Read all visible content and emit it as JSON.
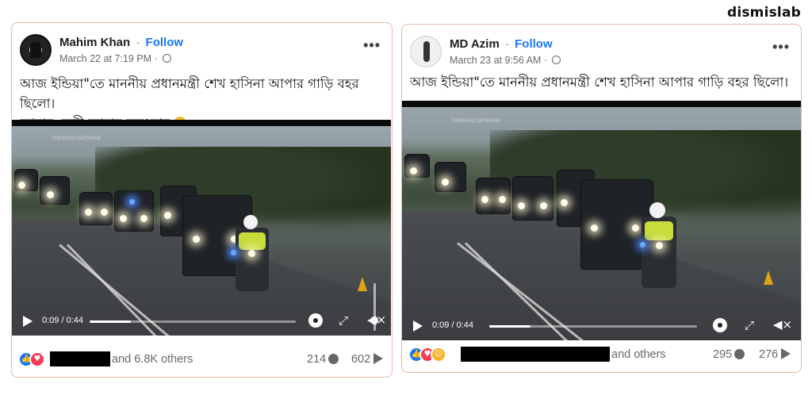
{
  "brand": "dismislab",
  "posts": [
    {
      "author": "Mahim Khan",
      "follow_label": "Follow",
      "separator": "·",
      "timestamp": "March 22 at 7:19 PM",
      "caption_line1": "আজ ইন্ডিয়া\"তে মাননীয় প্রধানমন্ত্রী শেখ হাসিনা আপার গাড়ি বহর ছিলো।",
      "caption_line2": "আমার নেত্রী আমার অহংকার",
      "video": {
        "time": "0:09 / 0:44",
        "progress": 0.2,
        "volume": 0.78
      },
      "reactions_label": "and 6.8K others",
      "comments": "214",
      "shares": "602"
    },
    {
      "author": "MD Azim",
      "follow_label": "Follow",
      "separator": "·",
      "timestamp": "March 23 at 9:56 AM",
      "caption_line1": "আজ ইন্ডিয়া\"তে মাননীয় প্রধানমন্ত্রী শেখ হাসিনা আপার গাড়ি বহর ছিলো।",
      "video": {
        "time": "0:09 / 0:44",
        "progress": 0.2
      },
      "reactions_label": "and others",
      "comments": "295",
      "shares": "276"
    }
  ],
  "icons": {
    "more": "more-options-icon",
    "globe": "globe-icon",
    "play": "play-icon",
    "settings": "gear-icon",
    "fullscreen": "expand-icon",
    "volume": "volume-muted-icon",
    "comment": "comment-icon",
    "share": "share-icon"
  },
  "colors": {
    "follow": "#1877f2",
    "like": "#1877f2",
    "love": "#f33e58",
    "haha": "#f7b125",
    "border": "#e8b7a8"
  }
}
